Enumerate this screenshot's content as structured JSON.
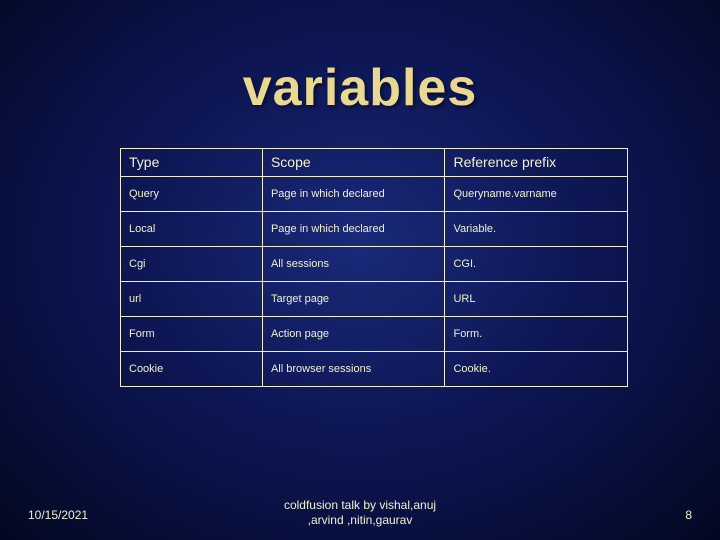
{
  "title": "variables",
  "table": {
    "headers": [
      "Type",
      "Scope",
      "Reference prefix"
    ],
    "rows": [
      [
        "Query",
        "Page in which declared",
        "Queryname.varname"
      ],
      [
        "Local",
        "Page in which declared",
        "Variable."
      ],
      [
        "Cgi",
        "All  sessions",
        "CGI."
      ],
      [
        "url",
        "Target page",
        "URL"
      ],
      [
        "Form",
        "Action page",
        "Form."
      ],
      [
        "Cookie",
        "All browser sessions",
        "Cookie."
      ]
    ]
  },
  "footer": {
    "date": "10/15/2021",
    "center_line1": "coldfusion talk by vishal,anuj",
    "center_line2": ",arvind ,nitin,gaurav",
    "page_number": "8"
  }
}
